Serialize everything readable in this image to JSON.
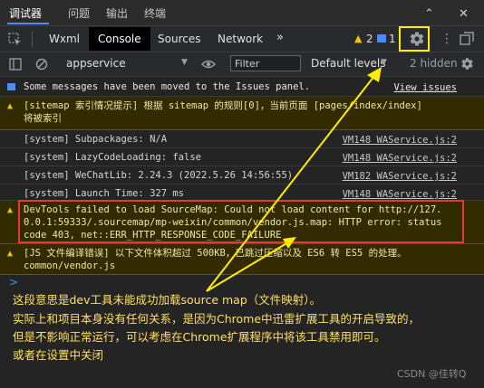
{
  "top_tabs": [
    "调试器",
    "问题",
    "输出",
    "终端"
  ],
  "devtools_tabs": [
    "Wxml",
    "Console",
    "Sources",
    "Network"
  ],
  "badges": {
    "warnings": "2",
    "info": "1"
  },
  "console_toolbar": {
    "context": "appservice",
    "filter_placeholder": "Filter",
    "levels": "Default levels",
    "hidden": "2 hidden"
  },
  "messages": [
    {
      "type": "info",
      "text": "Some messages have been moved to the Issues panel.",
      "link": "View issues"
    },
    {
      "type": "warn",
      "line1": "[sitemap 索引情况提示] 根据 sitemap 的规则[0]，当前页面 [pages/index/index]",
      "line2": "将被索引"
    },
    {
      "type": "log",
      "text": "[system] Subpackages: N/A",
      "src": "VM148 WAService.js:2"
    },
    {
      "type": "log",
      "text": "[system] LazyCodeLoading: false",
      "src": "VM148 WAService.js:2"
    },
    {
      "type": "log",
      "text": "[system] WeChatLib: 2.24.3 (2022.5.26 14:56:55)",
      "src": "VM182 WAService.js:2"
    },
    {
      "type": "log",
      "text": "[system] Launch Time: 327 ms",
      "src": "VM148 WAService.js:2"
    },
    {
      "type": "warn",
      "line1": "DevTools failed to load SourceMap: Could not load content for http://127.",
      "line2": "0.0.1:59333/.sourcemap/mp-weixin/common/vendor.js.map: HTTP error: status",
      "line3": "code 403, net::ERR_HTTP_RESPONSE_CODE_FAILURE"
    },
    {
      "type": "warn",
      "line1": "[JS 文件编译错误] 以下文件体积超过 500KB，已跳过压缩以及 ES6 转 ES5 的处理。",
      "line2": "common/vendor.js"
    }
  ],
  "prompt": ">",
  "annotation_lines": [
    "这段意思是dev工具未能成功加载source map（文件映射）。",
    "实际上和项目本身没有任何关系，是因为Chrome中迅雷扩展工具的开启导致的，",
    "但是不影响正常运行，可以考虑在Chrome扩展程序中将该工具禁用即可。",
    "或者在设置中关闭"
  ],
  "watermark": "CSDN @佳转Q",
  "colors": {
    "highlight_box": "#ffee00",
    "error_box": "#e53935",
    "arrow": "#ffee00"
  }
}
